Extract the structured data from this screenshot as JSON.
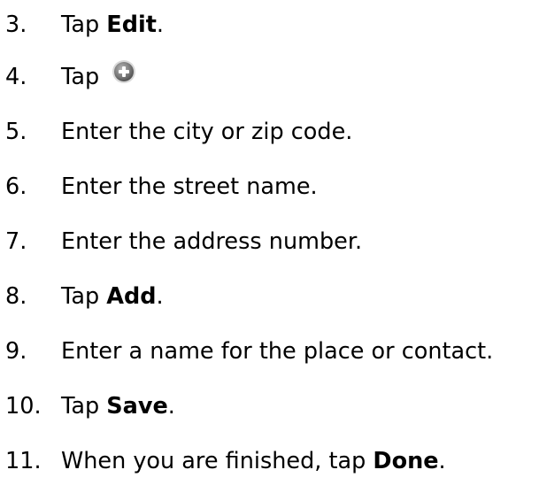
{
  "steps": [
    {
      "number": "3.",
      "before": "Tap ",
      "bold": "Edit",
      "after": "."
    },
    {
      "number": "4.",
      "before": "Tap",
      "icon": "plus-circle-icon"
    },
    {
      "number": "5.",
      "before": "Enter the city or zip code."
    },
    {
      "number": "6.",
      "before": "Enter the street name."
    },
    {
      "number": "7.",
      "before": "Enter the address number."
    },
    {
      "number": "8.",
      "before": "Tap ",
      "bold": "Add",
      "after": "."
    },
    {
      "number": "9.",
      "before": "Enter a name for the place or contact."
    },
    {
      "number": "10.",
      "before": "Tap ",
      "bold": "Save",
      "after": "."
    },
    {
      "number": "11.",
      "before": "When you are finished, tap ",
      "bold": "Done",
      "after": "."
    }
  ],
  "colors": {
    "text": "#000000",
    "icon_fill": "#7a7a7a",
    "icon_symbol": "#ffffff"
  }
}
